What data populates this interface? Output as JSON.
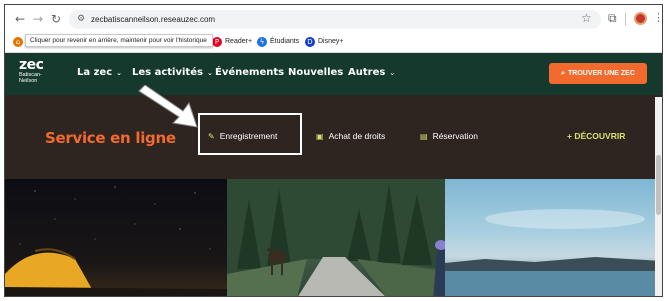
{
  "browser": {
    "url": "zecbatiscanneilson.reseauzec.com",
    "tooltip": "Cliquer pour revenir en arrière, maintenir pour voir l'historique",
    "bookmarks": [
      {
        "label": "Reader+",
        "icon": "pinterest-icon",
        "color": "#e60023"
      },
      {
        "label": "Étudiants",
        "icon": "zap-icon",
        "color": "#1a73e8"
      },
      {
        "label": "Disney+",
        "icon": "disney-icon",
        "color": "#113ccf"
      }
    ]
  },
  "site": {
    "logo": {
      "main": "zec",
      "sub1": "Batiscan-",
      "sub2": "Neilson"
    },
    "nav": [
      {
        "label": "La zec",
        "dropdown": true
      },
      {
        "label": "Les activités",
        "dropdown": true
      },
      {
        "label": "Événements",
        "dropdown": false
      },
      {
        "label": "Nouvelles",
        "dropdown": false
      },
      {
        "label": "Autres",
        "dropdown": true
      }
    ],
    "cta": "TROUVER UNE ZEC",
    "colors": {
      "nav_bg": "#16392d",
      "accent": "#f26a2e",
      "band_bg": "#2e2420",
      "lime": "#d7e36a"
    }
  },
  "service": {
    "title": "Service en ligne",
    "items": [
      {
        "label": "Enregistrement",
        "icon": "edit-icon"
      },
      {
        "label": "Achat de droits",
        "icon": "ticket-icon"
      },
      {
        "label": "Réservation",
        "icon": "calendar-icon"
      }
    ],
    "discover": "+ DÉCOUVRIR"
  }
}
